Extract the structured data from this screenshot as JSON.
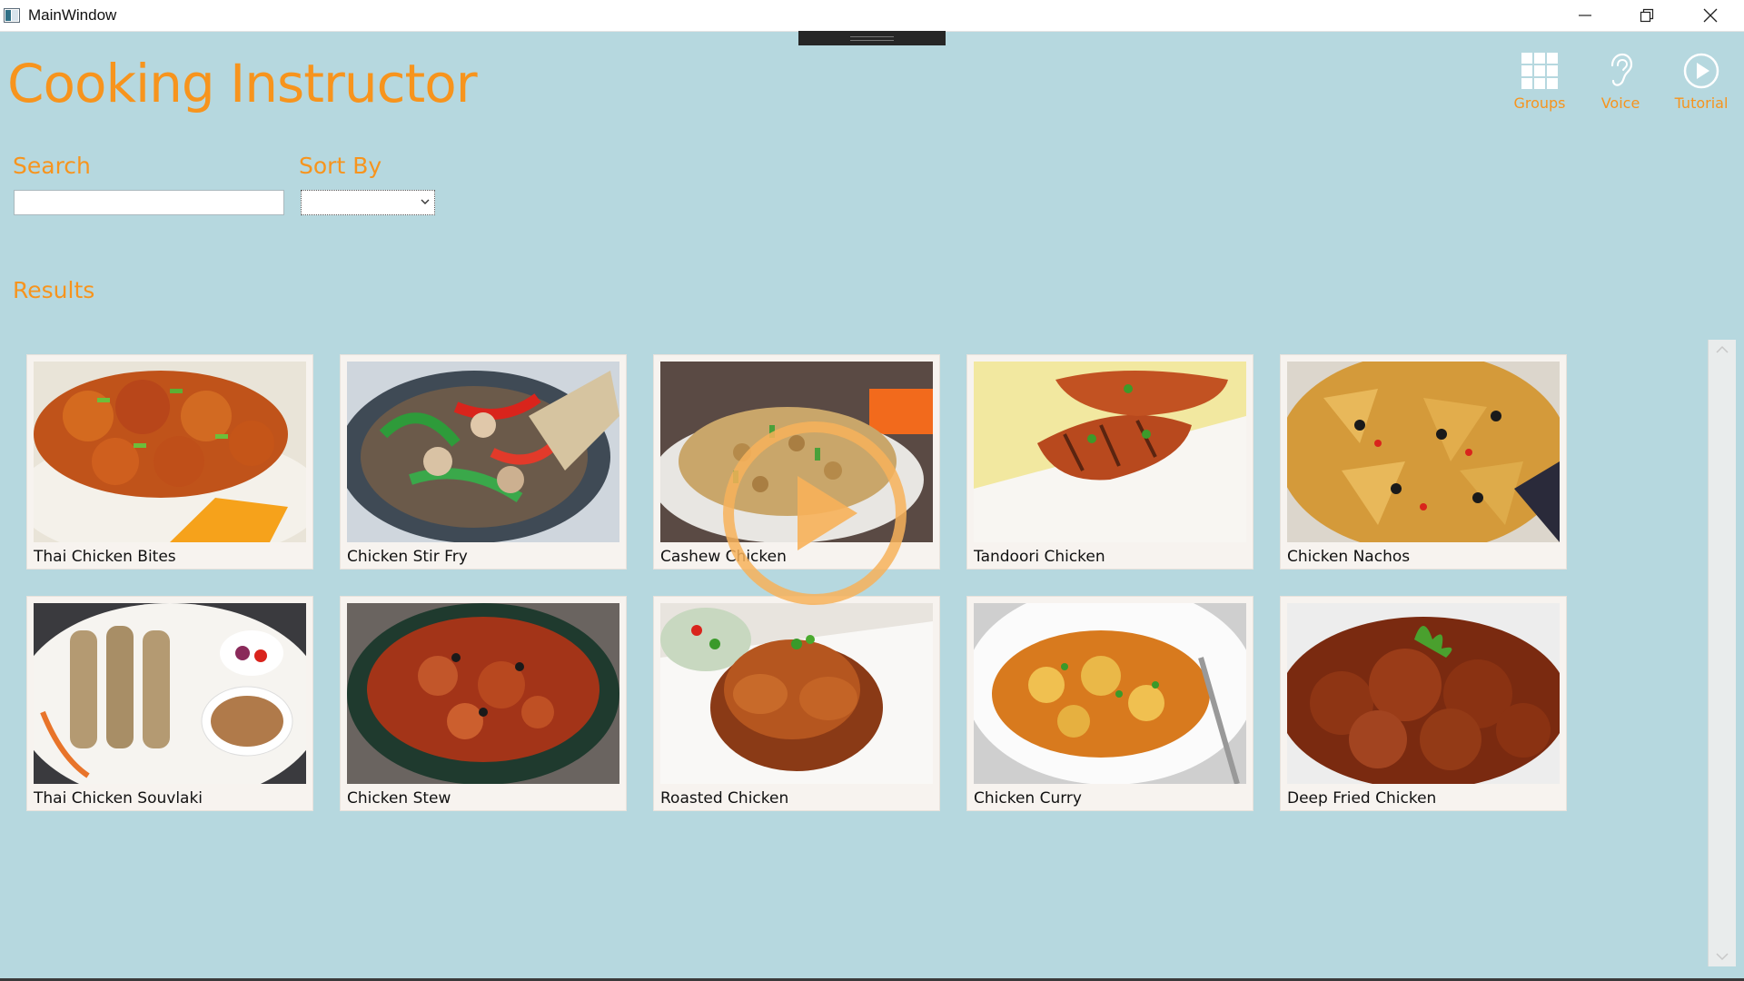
{
  "window": {
    "title": "MainWindow"
  },
  "app": {
    "title": "Cooking Instructor"
  },
  "toolbar": [
    {
      "id": "groups",
      "label": "Groups",
      "icon": "grid-icon"
    },
    {
      "id": "voice",
      "label": "Voice",
      "icon": "ear-icon"
    },
    {
      "id": "tutorial",
      "label": "Tutorial",
      "icon": "play-circle-icon"
    }
  ],
  "search": {
    "label": "Search",
    "value": "",
    "placeholder": ""
  },
  "sort": {
    "label": "Sort By",
    "selected": ""
  },
  "results": {
    "label": "Results",
    "items": [
      {
        "name": "Thai Chicken Bites"
      },
      {
        "name": "Chicken Stir Fry"
      },
      {
        "name": "Cashew Chicken"
      },
      {
        "name": "Tandoori Chicken"
      },
      {
        "name": "Chicken Nachos"
      },
      {
        "name": "Thai Chicken Souvlaki"
      },
      {
        "name": "Chicken Stew"
      },
      {
        "name": "Roasted Chicken"
      },
      {
        "name": "Chicken Curry"
      },
      {
        "name": "Deep Fried Chicken"
      }
    ]
  },
  "colors": {
    "accent": "#f7941d",
    "background": "#b6d8df",
    "card": "#f7f3ef"
  }
}
